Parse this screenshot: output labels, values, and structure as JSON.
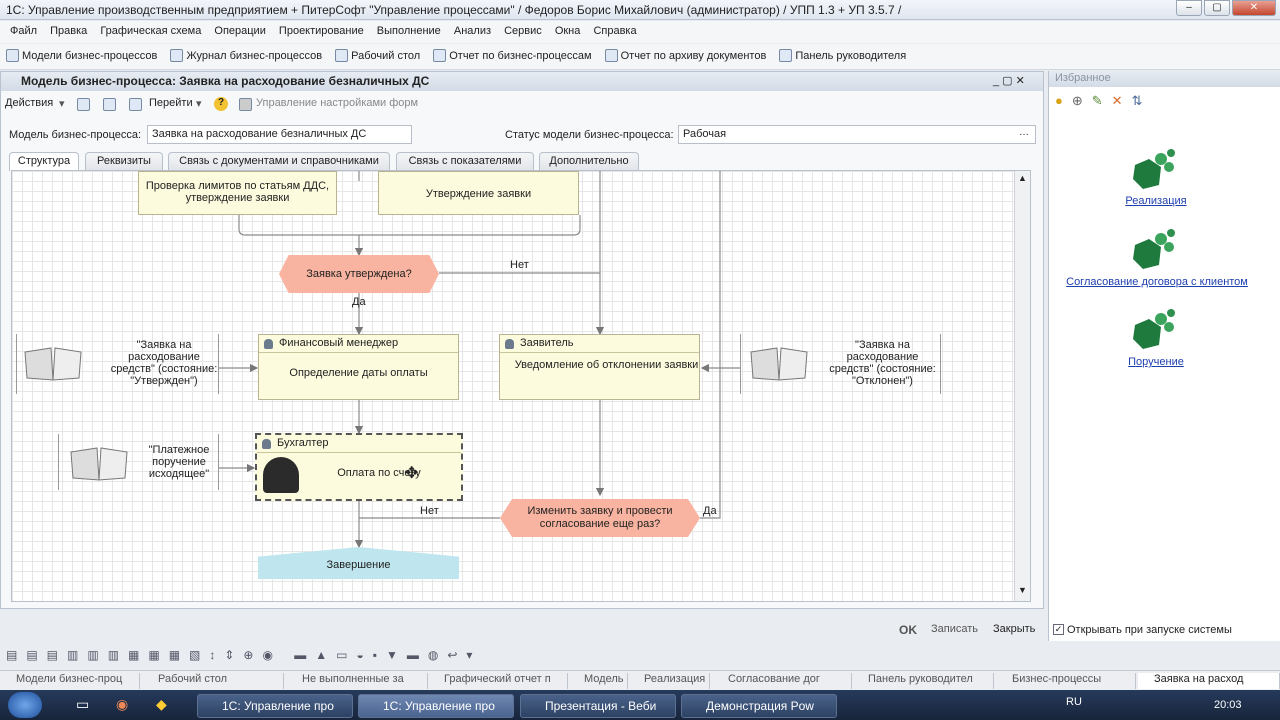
{
  "window": {
    "title": "1С: Управление производственным предприятием + ПитерСофт \"Управление процессами\" / Федоров Борис Михайлович (администратор) / УПП 1.3 + УП 3.5.7 /"
  },
  "menu": [
    "Файл",
    "Правка",
    "Графическая схема",
    "Операции",
    "Проектирование",
    "Выполнение",
    "Анализ",
    "Сервис",
    "Окна",
    "Справка"
  ],
  "favbar": [
    "Модели бизнес-процессов",
    "Журнал бизнес-процессов",
    "Рабочий стол",
    "Отчет по бизнес-процессам",
    "Отчет по архиву документов",
    "Панель руководителя"
  ],
  "doc": {
    "title": "Модель бизнес-процесса: Заявка на расходование безналичных ДС",
    "actions": "Действия",
    "goto": "Перейти",
    "form_settings": "Управление настройками форм",
    "model_label": "Модель бизнес-процесса:",
    "model_value": "Заявка на расходование безналичных ДС",
    "status_label": "Статус модели бизнес-процесса:",
    "status_value": "Рабочая",
    "tabs": [
      "Структура",
      "Реквизиты",
      "Связь с документами и справочниками",
      "Связь с показателями",
      "Дополнительно"
    ],
    "ok": "OK",
    "save": "Записать",
    "close": "Закрыть"
  },
  "diagram": {
    "check_limits": "Проверка лимитов по статьям ДДС, утверждение заявки",
    "approve": "Утверждение заявки",
    "decision1": "Заявка утверждена?",
    "no": "Нет",
    "yes": "Да",
    "fin_role": "Финансовый менеджер",
    "fin_task": "Определение даты оплаты",
    "app_role": "Заявитель",
    "app_task": "Уведомление об отклонении заявки",
    "acc_role": "Бухгалтер",
    "acc_task": "Оплата по счету",
    "decision2": "Изменить заявку и провести согласование еще раз?",
    "end": "Завершение",
    "doc_left1": "\"Заявка на расходование средств\" (состояние: \"Утвержден\")",
    "doc_right1": "\"Заявка на расходование средств\" (состояние: \"Отклонен\")",
    "doc_left2": "\"Платежное поручение исходящее\""
  },
  "favorites": {
    "title": "Избранное",
    "items": [
      "Реализация",
      "Согласование договора с клиентом",
      "Поручение"
    ],
    "open_on_start": "Открывать при запуске системы"
  },
  "window_list": [
    "Модели бизнес-проц",
    "Рабочий стол",
    "Не выполненные за",
    "Графический отчет п",
    "Модель",
    "Реализация",
    "Согласование дог",
    "Панель руководител",
    "Бизнес-процессы",
    "Заявка на расход"
  ],
  "taskbar": {
    "apps": [
      "1С: Управление про",
      "1С: Управление про",
      "Презентация - Веби",
      "Демонстрация Pow"
    ],
    "lang": "RU",
    "time": "20:03"
  }
}
